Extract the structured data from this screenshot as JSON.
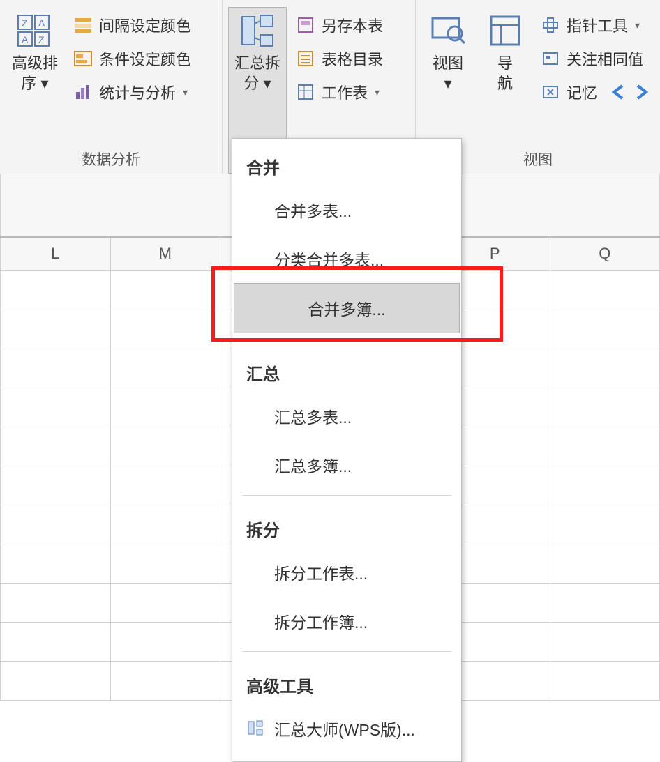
{
  "ribbon": {
    "group1": {
      "sort_btn": "高级排\n序 ▾",
      "items": [
        "间隔设定颜色",
        "条件设定颜色",
        "统计与分析"
      ],
      "label": "数据分析"
    },
    "group2": {
      "main_btn": "汇总拆\n分 ▾",
      "items": [
        "另存本表",
        "表格目录",
        "工作表"
      ]
    },
    "group3": {
      "btn1": "视图\n▾",
      "btn2": "导\n航",
      "items": [
        "指针工具",
        "关注相同值",
        "记忆"
      ],
      "label": "视图"
    }
  },
  "columns": [
    "L",
    "M",
    "",
    "",
    "P",
    "Q"
  ],
  "menu": {
    "section1": "合并",
    "items1": [
      "合并多表...",
      "分类合并多表..."
    ],
    "highlighted": "合并多簿...",
    "section2": "汇总",
    "items2": [
      "汇总多表...",
      "汇总多簿..."
    ],
    "section3": "拆分",
    "items3": [
      "拆分工作表...",
      "拆分工作簿..."
    ],
    "section4": "高级工具",
    "tool_item": "汇总大师(WPS版)..."
  }
}
